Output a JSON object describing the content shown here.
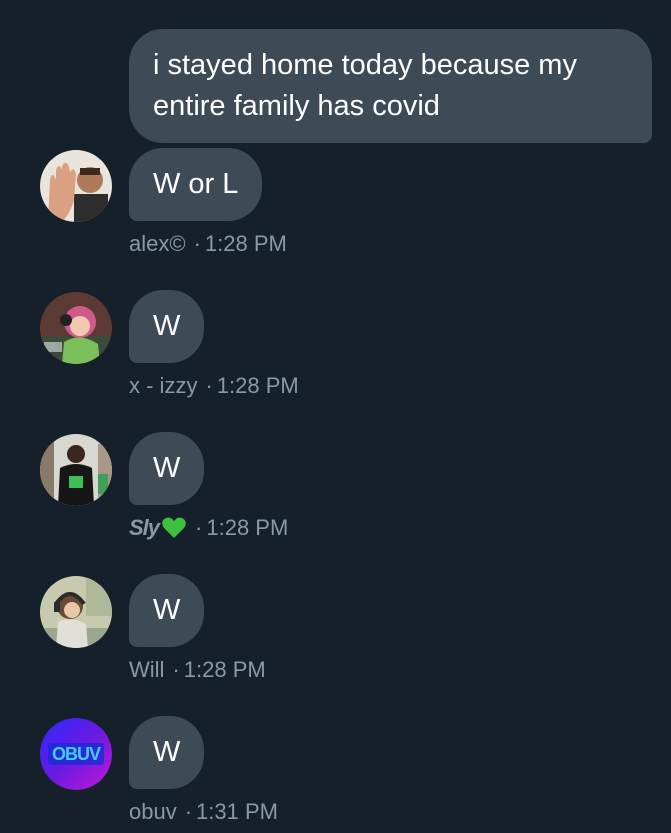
{
  "messages": [
    {
      "text": "i stayed home today because my entire family has covid"
    },
    {
      "text": "W or L",
      "avatar_icon": "raised-hand-man-avatar-icon",
      "sender": "alex©",
      "sep": "·",
      "time": "1:28 PM"
    },
    {
      "text": "W",
      "avatar_icon": "anime-girl-headphones-avatar-icon",
      "sender": "x - izzy",
      "sep": "·",
      "time": "1:28 PM"
    },
    {
      "text": "W",
      "avatar_icon": "man-crowd-photo-avatar-icon",
      "sender": "Sly",
      "sender_emoji": "green-heart-icon",
      "sep": "·",
      "time": "1:28 PM"
    },
    {
      "text": "W",
      "avatar_icon": "anime-headphones-room-avatar-icon",
      "sender": "Will",
      "sep": "·",
      "time": "1:28 PM"
    },
    {
      "text": "W",
      "avatar_icon": "obuv-logo-avatar-icon",
      "avatar_logo_text": "OBUV",
      "sender": "obuv",
      "sep": "·",
      "time": "1:31 PM"
    }
  ],
  "colors": {
    "background": "#15202b",
    "bubble": "#3f4a57",
    "text": "#ffffff",
    "meta": "#8b98a5",
    "heart": "#3fbf3f"
  }
}
